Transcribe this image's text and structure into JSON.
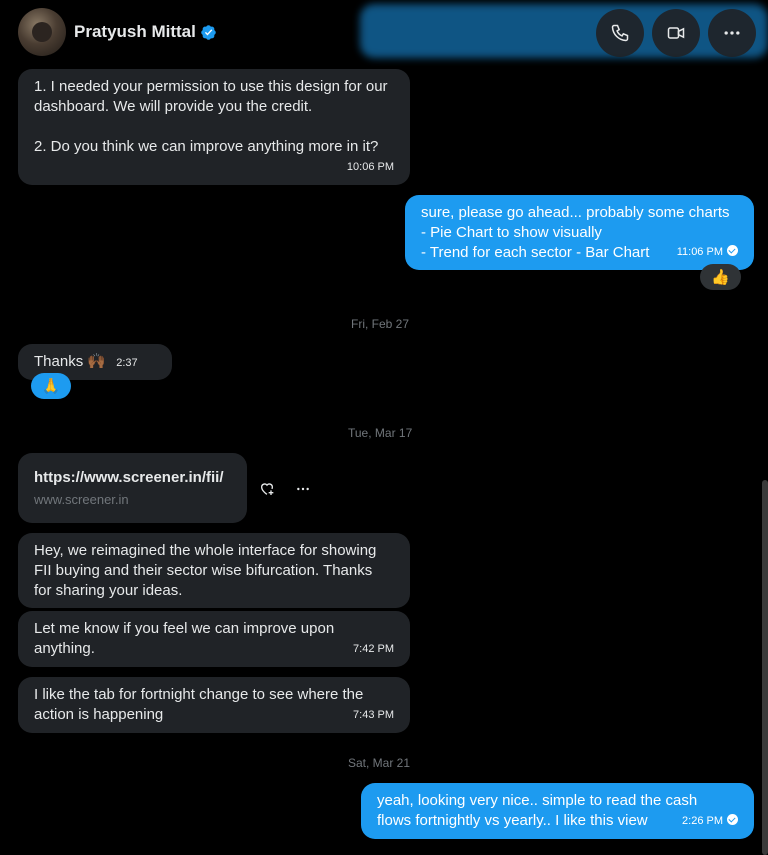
{
  "header": {
    "contact_name": "Pratyush Mittal",
    "verified": true,
    "actions": [
      {
        "icon": "phone-icon",
        "label": "Call"
      },
      {
        "icon": "video-icon",
        "label": "Video call"
      },
      {
        "icon": "more-icon",
        "label": "More"
      }
    ]
  },
  "colors": {
    "background": "#000000",
    "incoming_bubble": "#202327",
    "outgoing_bubble": "#1d9bf0",
    "muted_text": "#71767b",
    "verified_badge": "#1d9bf0"
  },
  "messages": [
    {
      "dir": "in",
      "lines": [
        "1. I needed your permission to use this design for our",
        "dashboard. We will provide you the credit.",
        "",
        "2. Do you think we can improve anything more in it?"
      ],
      "time": "10:06 PM"
    },
    {
      "dir": "out",
      "lines": [
        "sure, please go ahead... probably some charts",
        "- Pie Chart to show visually",
        "- Trend for each sector   - Bar Chart"
      ],
      "time": "11:06 PM",
      "reaction": "👍"
    },
    {
      "date": "Fri, Feb 27"
    },
    {
      "dir": "in",
      "text": "Thanks 🙌🏾",
      "time": "2:37 PM",
      "reaction": "🙏"
    },
    {
      "date": "Tue, Mar 17"
    },
    {
      "link": {
        "url": "https://www.screener.in/fii/",
        "domain": "www.screener.in"
      }
    },
    {
      "dir": "in",
      "lines": [
        "Hey, we reimagined the whole interface for showing",
        "FII buying and their sector wise bifurcation. Thanks",
        "for sharing your ideas."
      ]
    },
    {
      "dir": "in",
      "lines": [
        "Let me know if you feel we can improve upon",
        "anything."
      ],
      "time": "7:42 PM"
    },
    {
      "dir": "in",
      "lines": [
        "I like the tab for fortnight change to see where the",
        "action is happening"
      ],
      "time": "7:43 PM"
    },
    {
      "date": "Sat, Mar 21"
    },
    {
      "dir": "out",
      "lines": [
        "yeah, looking very nice.. simple to read the cash",
        "flows fortnightly vs yearly.. I like this view"
      ],
      "time": "2:26 PM"
    }
  ],
  "bound": {
    "m1": {
      "l1": "1. I needed your permission to use this design for our",
      "l2": "dashboard. We will provide you the credit.",
      "l4": "2. Do you think we can improve anything more in it?",
      "time": "10:06 PM"
    },
    "m2": {
      "l1": "sure, please go ahead... probably some charts",
      "l2": "- Pie Chart to show visually",
      "l3": "- Trend for each sector   - Bar Chart",
      "time": "11:06 PM",
      "reaction": "👍"
    },
    "d1": "Fri, Feb 27",
    "m3": {
      "text": "Thanks 🙌🏾",
      "time": "2:37 PM",
      "reaction": "🙏"
    },
    "d2": "Tue, Mar 17",
    "link": {
      "url": "https://www.screener.in/fii/",
      "domain": "www.screener.in"
    },
    "m4": {
      "l1": "Hey, we reimagined the whole interface for showing",
      "l2": "FII buying and their sector wise bifurcation. Thanks",
      "l3": "for sharing your ideas."
    },
    "m5": {
      "l1": "Let me know if you feel we can improve upon",
      "l2": "anything.",
      "time": "7:42 PM"
    },
    "m6": {
      "l1": "I like the tab for fortnight change to see where the",
      "l2": "action is happening",
      "time": "7:43 PM"
    },
    "d3": "Sat, Mar 21",
    "m7": {
      "l1": "yeah, looking very nice.. simple to read the cash",
      "l2": "flows fortnightly vs yearly.. I like this view",
      "time": "2:26 PM"
    }
  }
}
